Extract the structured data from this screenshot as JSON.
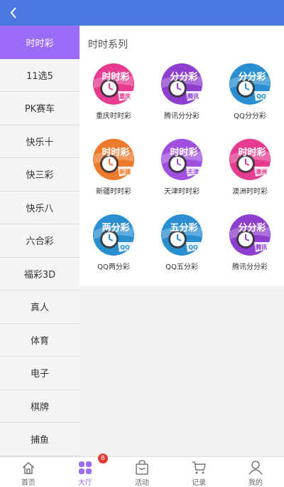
{
  "sidebar": {
    "items": [
      {
        "label": "时时彩",
        "active": true
      },
      {
        "label": "11选5"
      },
      {
        "label": "PK赛车"
      },
      {
        "label": "快乐十"
      },
      {
        "label": "快三彩"
      },
      {
        "label": "快乐八"
      },
      {
        "label": "六合彩"
      },
      {
        "label": "福彩3D"
      },
      {
        "label": "真人"
      },
      {
        "label": "体育"
      },
      {
        "label": "电子"
      },
      {
        "label": "棋牌"
      },
      {
        "label": "捕鱼"
      }
    ]
  },
  "main": {
    "section_title": "时时系列",
    "games": [
      {
        "label": "重庆时时彩",
        "icon_title": "时时彩",
        "icon_tag": "重庆",
        "color": "#e63b8f"
      },
      {
        "label": "腾讯分分彩",
        "icon_title": "分分彩",
        "icon_tag": "腾讯",
        "color": "#8e3fcf"
      },
      {
        "label": "QQ分分彩",
        "icon_title": "分分彩",
        "icon_tag": "QQ",
        "color": "#2a8fd0"
      },
      {
        "label": "新疆时时彩",
        "icon_title": "时时彩",
        "icon_tag": "新疆",
        "color": "#ee7a2c"
      },
      {
        "label": "天津时时彩",
        "icon_title": "时时彩",
        "icon_tag": "天津",
        "color": "#a04fe0"
      },
      {
        "label": "澳洲时时彩",
        "icon_title": "时时彩",
        "icon_tag": "澳洲",
        "color": "#e63b8f"
      },
      {
        "label": "QQ两分彩",
        "icon_title": "两分彩",
        "icon_tag": "QQ",
        "color": "#2a8fd0"
      },
      {
        "label": "QQ五分彩",
        "icon_title": "五分彩",
        "icon_tag": "QQ",
        "color": "#2a8fd0"
      },
      {
        "label": "腾讯分分彩",
        "icon_title": "分分彩",
        "icon_tag": "腾讯",
        "color": "#8e3fcf"
      }
    ]
  },
  "tabbar": {
    "tabs": [
      {
        "label": "首页",
        "icon": "home-icon"
      },
      {
        "label": "大厅",
        "icon": "grid-icon",
        "active": true
      },
      {
        "label": "活动",
        "icon": "bag-icon"
      },
      {
        "label": "记录",
        "icon": "cart-icon"
      },
      {
        "label": "我的",
        "icon": "user-icon"
      }
    ],
    "badge_count": "8"
  },
  "colors": {
    "header": "#4b78e0",
    "accent": "#9b6cf7",
    "badge": "#e53935"
  }
}
